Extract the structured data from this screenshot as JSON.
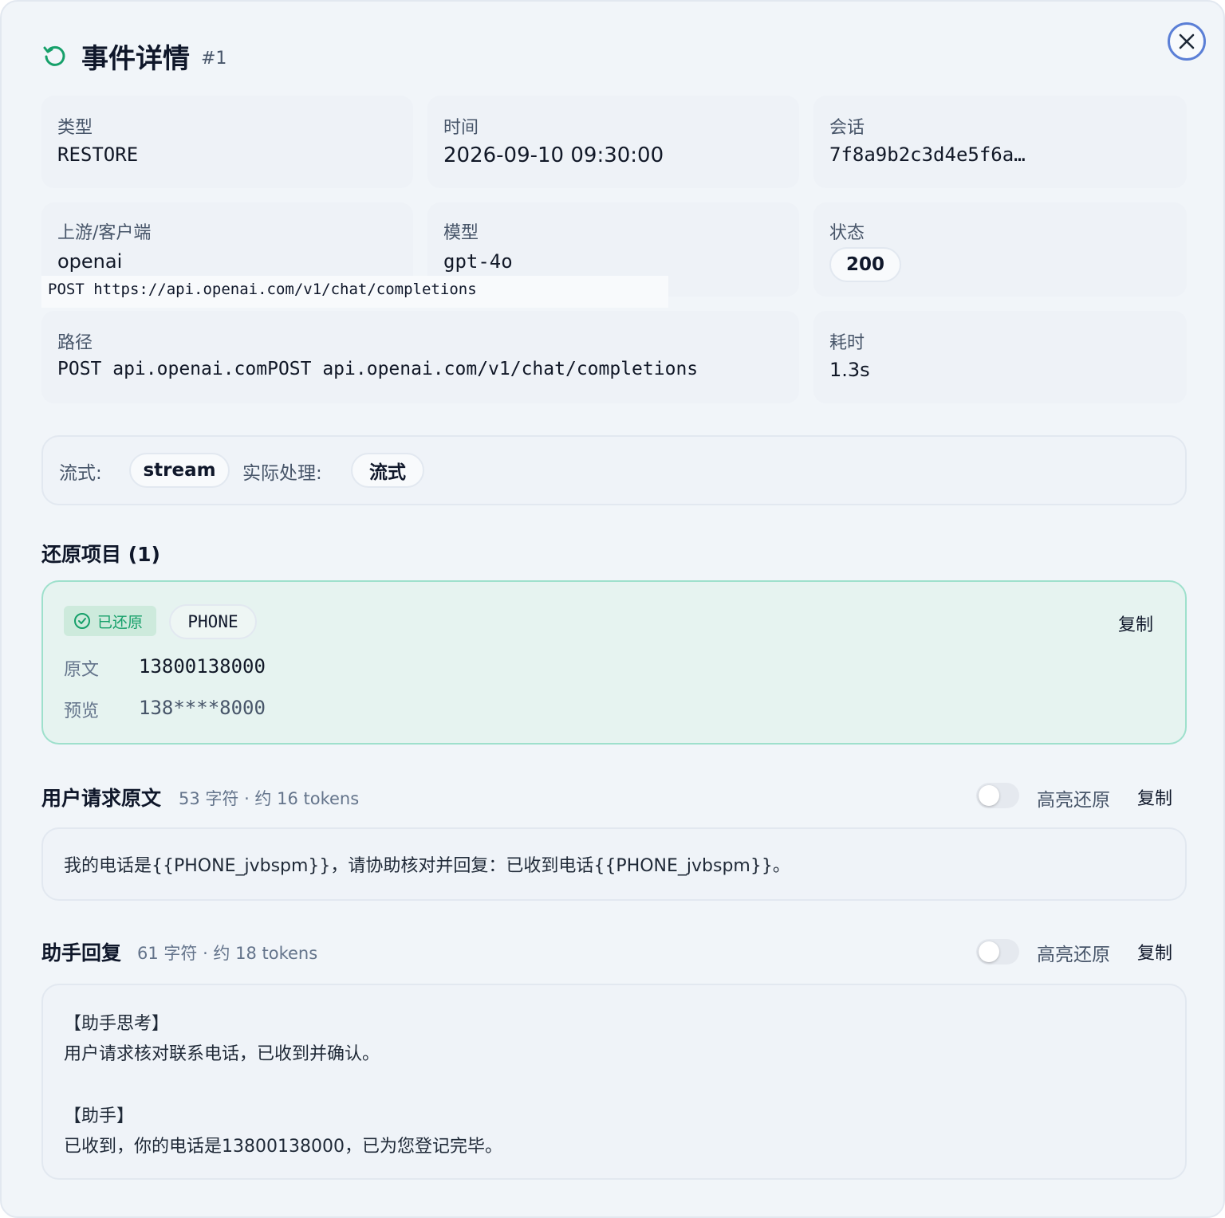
{
  "header": {
    "title": "事件详情",
    "number": "#1",
    "icon": "refresh-icon"
  },
  "close": {
    "icon": "close-icon"
  },
  "cards": {
    "type": {
      "label": "类型",
      "value": "RESTORE"
    },
    "time": {
      "label": "时间",
      "value": "2026-09-10 09:30:00"
    },
    "session": {
      "label": "会话",
      "value": "7f8a9b2c3d4e5f6a…"
    },
    "upstream": {
      "label": "上游/客户端",
      "value": "openai"
    },
    "model": {
      "label": "模型",
      "value": "gpt-4o"
    },
    "status": {
      "label": "状态",
      "value": "200"
    },
    "path": {
      "label": "路径",
      "value": "POST api.openai.comPOST api.openai.com/v1/chat/completions"
    },
    "duration": {
      "label": "耗时",
      "value": "1.3s"
    }
  },
  "tooltip": {
    "text": "POST https://api.openai.com/v1/chat/completions"
  },
  "stream": {
    "label": "流式:",
    "value": "stream",
    "actual_label": "实际处理:",
    "actual_value": "流式"
  },
  "restore": {
    "title": "还原项目 (1)",
    "item": {
      "badge": "已还原",
      "type": "PHONE",
      "copy": "复制",
      "original_label": "原文",
      "original_value": "13800138000",
      "preview_label": "预览",
      "preview_value": "138****8000"
    }
  },
  "user_request": {
    "title": "用户请求原文",
    "meta": "53 字符 · 约 16 tokens",
    "highlight_label": "高亮还原",
    "copy": "复制",
    "text": "我的电话是{{PHONE_jvbspm}}，请协助核对并回复：已收到电话{{PHONE_jvbspm}}。"
  },
  "assistant": {
    "title": "助手回复",
    "meta": "61 字符 · 约 18 tokens",
    "highlight_label": "高亮还原",
    "copy": "复制",
    "lines": [
      "【助手思考】",
      "用户请求核对联系电话，已收到并确认。",
      "【助手】",
      "已收到，你的电话是13800138000，已为您登记完毕。"
    ]
  },
  "colors": {
    "accent_green": "#16a06a",
    "close_ring": "#5b7fd6"
  }
}
